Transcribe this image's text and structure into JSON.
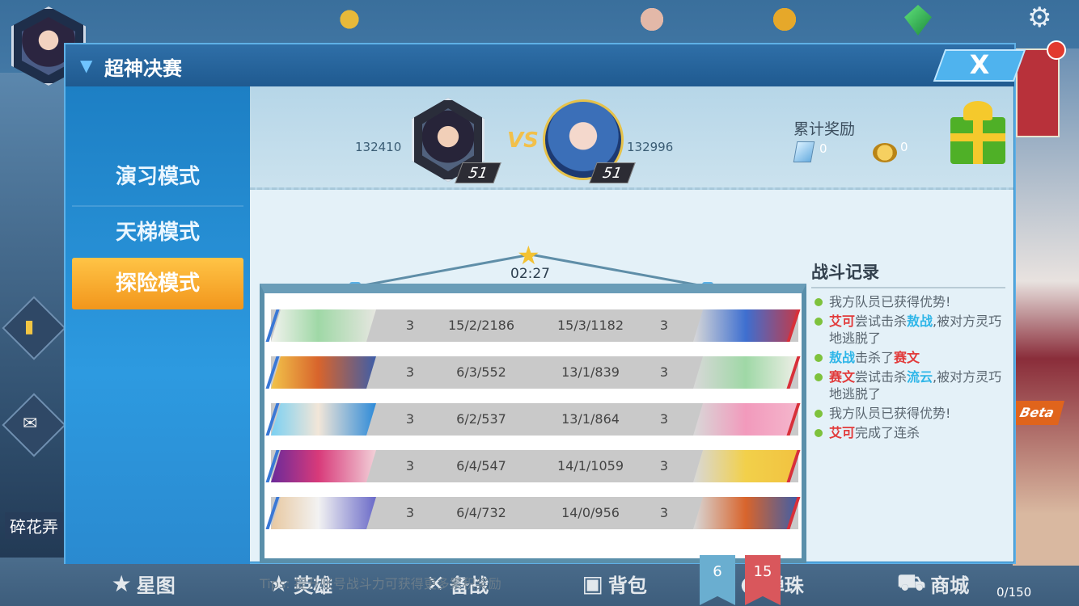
{
  "dialog": {
    "title": "超神决赛",
    "close_label": "X"
  },
  "menu": {
    "items": [
      {
        "label": "演习模式"
      },
      {
        "label": "天梯模式"
      },
      {
        "label": "探险模式",
        "selected": true
      }
    ]
  },
  "match": {
    "left": {
      "score": "132410",
      "level": "51"
    },
    "right": {
      "score": "132996",
      "level": "51"
    },
    "vs_label": "VS",
    "timer": "02:27"
  },
  "rewards": {
    "title": "累计奖励",
    "crystal": "0",
    "coins": "0"
  },
  "battle_rows": [
    {
      "left_level": "3",
      "left_stats": "15/2/2186",
      "right_stats": "15/3/1182",
      "right_level": "3"
    },
    {
      "left_level": "3",
      "left_stats": "6/3/552",
      "right_stats": "13/1/839",
      "right_level": "3"
    },
    {
      "left_level": "3",
      "left_stats": "6/2/537",
      "right_stats": "13/1/864",
      "right_level": "3"
    },
    {
      "left_level": "3",
      "left_stats": "6/4/547",
      "right_stats": "14/1/1059",
      "right_level": "3"
    },
    {
      "left_level": "3",
      "left_stats": "6/4/732",
      "right_stats": "14/0/956",
      "right_level": "3"
    }
  ],
  "team_scores": {
    "blue": "6",
    "red": "15"
  },
  "tips": "Tips: 提升账号战斗力可获得更多累积奖励",
  "battle_log": {
    "title": "战斗记录",
    "entries": {
      "e1": "我方队员已获得优势!",
      "e2_a": "艾可",
      "e2_b": "尝试击杀",
      "e2_c": "敖战",
      "e2_d": ",被对方灵巧地逃脱了",
      "e3_a": "敖战",
      "e3_b": "击杀了",
      "e3_c": "赛文",
      "e4_a": "赛文",
      "e4_b": "尝试击杀",
      "e4_c": "流云",
      "e4_d": ",被对方灵巧地逃脱了",
      "e5": "我方队员已获得优势!",
      "e6_a": "艾可",
      "e6_b": "完成了连杀"
    }
  },
  "bottom_nav": [
    {
      "label": "星图"
    },
    {
      "label": "英雄"
    },
    {
      "label": "备战"
    },
    {
      "label": "背包"
    },
    {
      "label": "弹珠"
    },
    {
      "label": "商城"
    }
  ],
  "background": {
    "left_label": "碎花弄",
    "right_badge": "Beta",
    "right_counter": "0/150"
  },
  "colors": {
    "selected_menu": "#f2a524",
    "team_blue": "#6aaed0",
    "team_red": "#d9575c",
    "name_red": "#e23b3b",
    "name_blue": "#2fb6e8"
  }
}
